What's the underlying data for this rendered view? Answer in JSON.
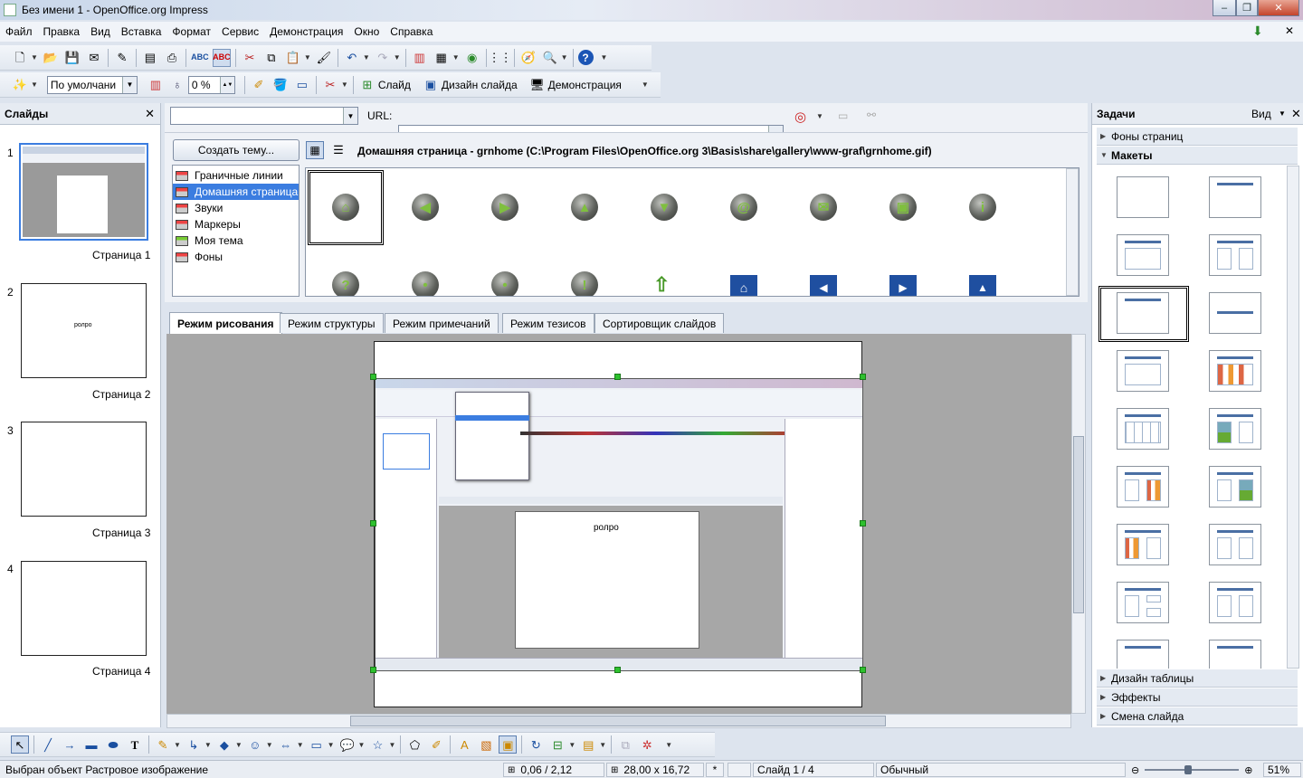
{
  "window": {
    "title": "Без имени 1 - OpenOffice.org Impress",
    "min": "–",
    "max": "❐",
    "close": "✕"
  },
  "menu": [
    "Файл",
    "Правка",
    "Вид",
    "Вставка",
    "Формат",
    "Сервис",
    "Демонстрация",
    "Окно",
    "Справка"
  ],
  "toolbar2": {
    "style_value": "По умолчани",
    "transparency_value": "0 %",
    "slide_label": "Слайд",
    "layout_label": "Дизайн слайда",
    "show_label": "Демонстрация"
  },
  "slides_panel": {
    "title": "Слайды",
    "slides": [
      {
        "num": "1",
        "label": "Страница 1"
      },
      {
        "num": "2",
        "label": "Страница 2",
        "text": "ролро"
      },
      {
        "num": "3",
        "label": "Страница 3"
      },
      {
        "num": "4",
        "label": "Страница 4"
      }
    ]
  },
  "gallery": {
    "url_label": "URL:",
    "create_theme": "Создать тему...",
    "path": "Домашняя страница - grnhome (C:\\Program Files\\OpenOffice.org 3\\Basis\\share\\gallery\\www-graf\\grnhome.gif)",
    "themes": [
      "Граничные линии",
      "Домашняя страница",
      "Звуки",
      "Маркеры",
      "Моя тема",
      "Фоны"
    ],
    "selected_theme": "Домашняя страница"
  },
  "tabs": [
    "Режим рисования",
    "Режим структуры",
    "Режим примечаний",
    "Режим тезисов",
    "Сортировщик слайдов"
  ],
  "canvas": {
    "embedded_text": "ролро"
  },
  "tasks": {
    "title": "Задачи",
    "view_label": "Вид",
    "sections_top": [
      "Фоны страниц",
      "Макеты"
    ],
    "sections_bottom": [
      "Дизайн таблицы",
      "Эффекты",
      "Смена слайда"
    ]
  },
  "statusbar": {
    "message": "Выбран объект Растровое изображение",
    "position": "0,06 / 2,12",
    "size": "28,00 x 16,72",
    "modified": "*",
    "slide": "Слайд 1 / 4",
    "master": "Обычный",
    "zoom": "51%"
  },
  "icons": {
    "gallery_icons": [
      "home-icon",
      "left-arrow-icon",
      "right-arrow-icon",
      "up-arrow-icon",
      "down-arrow-icon",
      "at-icon",
      "mail-icon",
      "save-icon",
      "info-icon"
    ]
  }
}
